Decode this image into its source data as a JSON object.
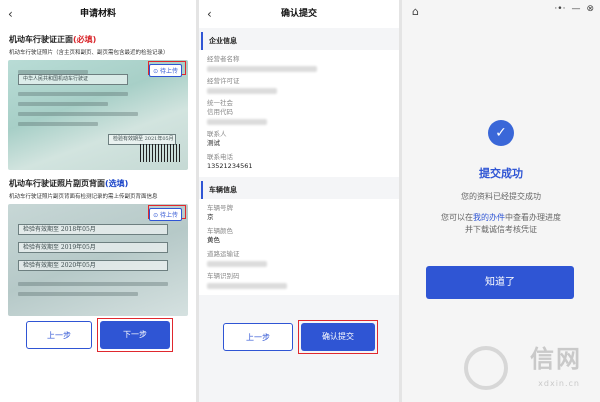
{
  "panel1": {
    "back_icon": "chevron-left-icon",
    "title": "申请材料",
    "front": {
      "title_main": "机动车行驶证正面",
      "title_tag": "(必填)",
      "subtitle": "机动车行驶证照片（含主页和副页、副页需包含最近的检验记录）",
      "upload_label": "⊙ 待上传",
      "photo_lines": [
        "中华人民共和国机动车行驶证",
        "检验有效期至 2021年05月"
      ]
    },
    "back": {
      "title_main": "机动车行驶证照片副页背面",
      "title_tag": "(选填)",
      "subtitle": "机动车行驶证照片副页背面有检测记录的需上传副页背面信息",
      "upload_label": "⊙ 待上传",
      "records": [
        "检验有效期至 2018年05月",
        "检验有效期至 2019年05月",
        "检验有效期至 2020年05月"
      ]
    },
    "prev_label": "上一步",
    "next_label": "下一步"
  },
  "panel2": {
    "back_icon": "chevron-left-icon",
    "title": "确认提交",
    "company_group": "企业信息",
    "company_fields": [
      {
        "label": "经营者名称",
        "value": ""
      },
      {
        "label": "经营许可证",
        "value": ""
      },
      {
        "label": "统一社会\n信用代码",
        "value": ""
      },
      {
        "label": "联系人",
        "value": "测试"
      },
      {
        "label": "联系电话",
        "value": "13521234561"
      }
    ],
    "vehicle_group": "车辆信息",
    "vehicle_fields": [
      {
        "label": "车辆号牌",
        "value": "京"
      },
      {
        "label": "车辆颜色",
        "value": "黄色"
      },
      {
        "label": "道路运输证",
        "value": ""
      },
      {
        "label": "车辆识别码",
        "value": ""
      }
    ],
    "prev_label": "上一步",
    "submit_label": "确认提交"
  },
  "panel3": {
    "home_icon": "home-icon",
    "dots": "·•·",
    "minimize": "—",
    "close": "⊗",
    "check": "✓",
    "success_title": "提交成功",
    "success_msg": "您的资料已经提交成功",
    "hint_pre": "您可以在",
    "hint_link": "我的办件",
    "hint_post": "中查看办理进度",
    "hint_line2": "并下载诚信考核凭证",
    "confirm_label": "知道了",
    "watermark_text": "信网",
    "watermark_sub": "xdxin.cn"
  },
  "colors": {
    "accent": "#2f55d4",
    "required": "#d9262b",
    "highlight": "#e0282e"
  }
}
